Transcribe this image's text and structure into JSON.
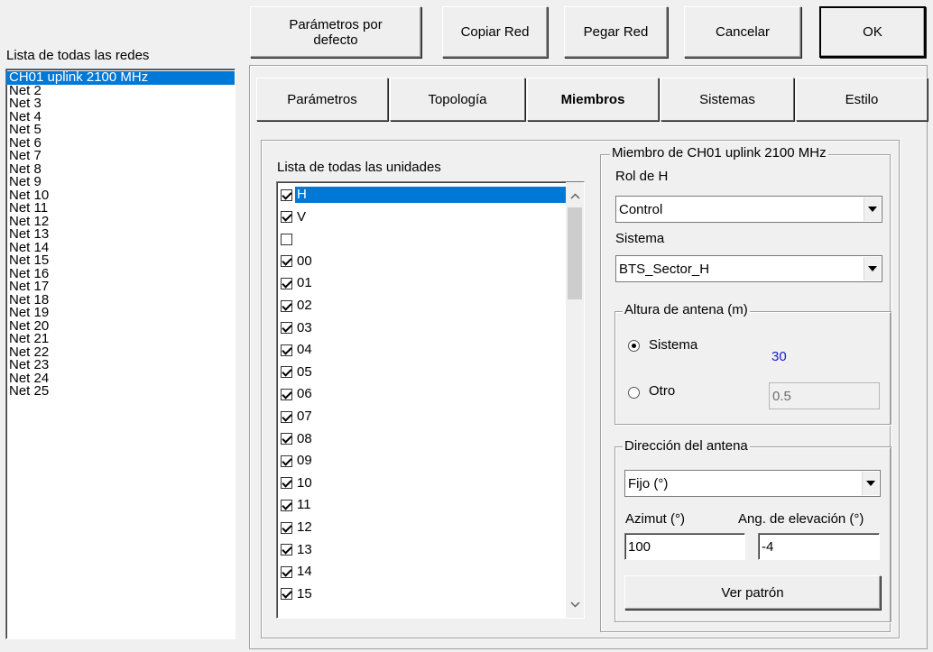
{
  "networks": {
    "title": "Lista de todas las redes",
    "items": [
      "CH01 uplink 2100 MHz",
      "Net  2",
      "Net  3",
      "Net  4",
      "Net  5",
      "Net  6",
      "Net  7",
      "Net  8",
      "Net  9",
      "Net 10",
      "Net 11",
      "Net 12",
      "Net 13",
      "Net 14",
      "Net 15",
      "Net 16",
      "Net 17",
      "Net 18",
      "Net 19",
      "Net 20",
      "Net 21",
      "Net 22",
      "Net 23",
      "Net 24",
      "Net 25"
    ],
    "selected_index": 0
  },
  "toolbar": {
    "defaults_label": "Parámetros por\ndefecto",
    "copy_label": "Copiar Red",
    "paste_label": "Pegar Red",
    "cancel_label": "Cancelar",
    "ok_label": "OK"
  },
  "tabs": [
    {
      "label": "Parámetros",
      "active": false
    },
    {
      "label": "Topología",
      "active": false
    },
    {
      "label": "Miembros",
      "active": true
    },
    {
      "label": "Sistemas",
      "active": false
    },
    {
      "label": "Estilo",
      "active": false
    }
  ],
  "units": {
    "title": "Lista de todas las unidades",
    "items": [
      {
        "label": "H",
        "checked": true,
        "selected": true
      },
      {
        "label": "V",
        "checked": true
      },
      {
        "label": "",
        "checked": false
      },
      {
        "label": "00",
        "checked": true
      },
      {
        "label": "01",
        "checked": true
      },
      {
        "label": "02",
        "checked": true
      },
      {
        "label": "03",
        "checked": true
      },
      {
        "label": "04",
        "checked": true
      },
      {
        "label": "05",
        "checked": true
      },
      {
        "label": "06",
        "checked": true
      },
      {
        "label": "07",
        "checked": true
      },
      {
        "label": "08",
        "checked": true
      },
      {
        "label": "09",
        "checked": true
      },
      {
        "label": "10",
        "checked": true
      },
      {
        "label": "11",
        "checked": true
      },
      {
        "label": "12",
        "checked": true
      },
      {
        "label": "13",
        "checked": true
      },
      {
        "label": "14",
        "checked": true
      },
      {
        "label": "15",
        "checked": true
      }
    ]
  },
  "member": {
    "group_title": "Miembro de CH01 uplink 2100 MHz",
    "role_label": "Rol de H",
    "role_value": "Control",
    "system_label": "Sistema",
    "system_value": "BTS_Sector_H",
    "height": {
      "title": "Altura de antena (m)",
      "system_option": "Sistema",
      "system_value": "30",
      "other_option": "Otro",
      "other_value": "0.5",
      "selected": "system"
    },
    "direction": {
      "title": "Dirección del antena",
      "mode_value": "Fijo (°)",
      "azimuth_label": "Azimut (°)",
      "azimuth_value": "100",
      "elevation_label": "Ang. de elevación (°)",
      "elevation_value": "-4",
      "pattern_button": "Ver patrón"
    }
  },
  "colors": {
    "selection": "#0078d7",
    "value_blue": "#1a1acc"
  }
}
